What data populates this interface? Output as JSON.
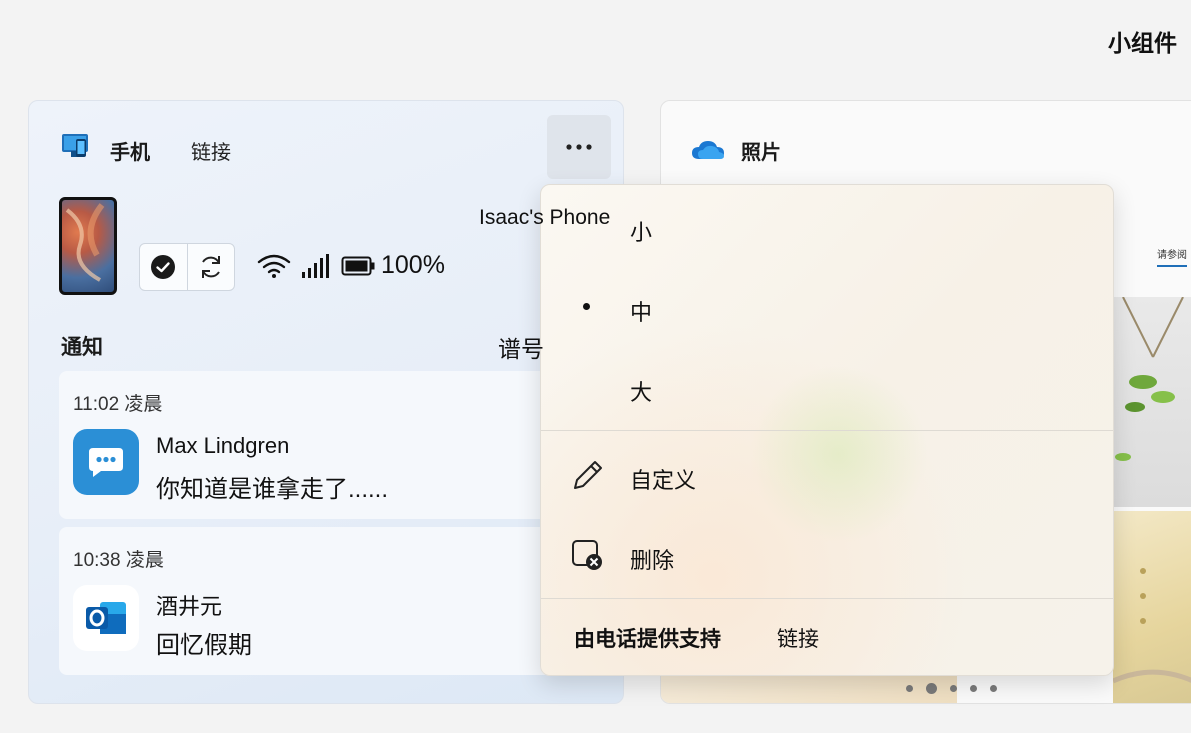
{
  "page": {
    "title": "小组件"
  },
  "phone_widget": {
    "title": "手机",
    "subtitle": "链接",
    "device_name": "Isaac's Phone",
    "battery": "100%",
    "notifications_header": "通知",
    "sort_label": "谱号",
    "notifications": [
      {
        "time": "11:02 凌晨",
        "sender": "Max Lindgren",
        "body": "你知道是谁拿走了......",
        "app_icon": "messages-icon",
        "icon_color": "#2b8fd6"
      },
      {
        "time": "10:38 凌晨",
        "sender": "酒井元",
        "body": "回忆假期",
        "app_icon": "outlook-icon",
        "icon_color": "#0f6cbd"
      }
    ]
  },
  "photos_widget": {
    "title": "照片",
    "tab_label": "请参阅",
    "pager_count": 5,
    "pager_active": 2
  },
  "menu": {
    "sizes": [
      {
        "label": "小",
        "selected": false
      },
      {
        "label": "中",
        "selected": true
      },
      {
        "label": "大",
        "selected": false
      }
    ],
    "customize_label": "自定义",
    "delete_label": "删除",
    "powered_by": "由电话提供支持",
    "link_label": "链接"
  }
}
